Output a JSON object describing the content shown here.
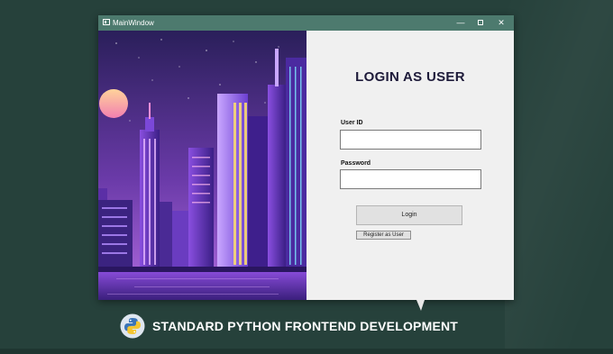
{
  "window": {
    "title": "MainWindow",
    "controls": {
      "minimize": "—",
      "maximize": "",
      "close": "✕"
    },
    "titlebar_color": "#4d7a6e"
  },
  "login": {
    "heading": "LOGIN AS USER",
    "user_id_label": "User ID",
    "user_id_value": "",
    "password_label": "Password",
    "password_value": "",
    "login_button": "Login",
    "register_button": "Register as User"
  },
  "banner": {
    "text": "STANDARD PYTHON FRONTEND DEVELOPMENT",
    "logo": "python-logo-icon"
  },
  "colors": {
    "background": "#26413b",
    "accent_purple": "#7b3fd1",
    "heading": "#1e1b3a"
  },
  "image": {
    "subject": "city-skyline-illustration"
  }
}
